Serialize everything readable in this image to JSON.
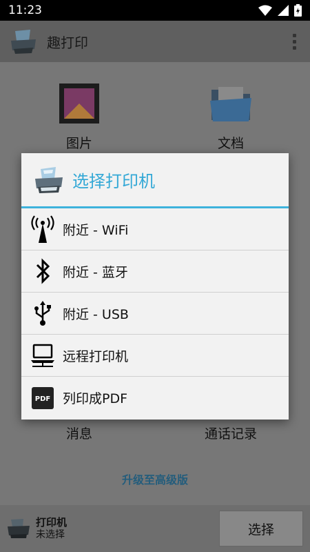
{
  "status_bar": {
    "time": "11:23"
  },
  "app_bar": {
    "title": "趣打印"
  },
  "tiles": {
    "photos": "图片",
    "documents": "文档",
    "messages": "消息",
    "call_log": "通话记录"
  },
  "upgrade": "升级至高级版",
  "bottom_bar": {
    "printer_label": "打印机",
    "printer_status": "未选择",
    "select_label": "选择"
  },
  "dialog": {
    "title": "选择打印机",
    "items": [
      {
        "label": "附近 - WiFi",
        "icon": "wifi-antenna-icon"
      },
      {
        "label": "附近 - 蓝牙",
        "icon": "bluetooth-icon"
      },
      {
        "label": "附近 - USB",
        "icon": "usb-icon"
      },
      {
        "label": "远程打印机",
        "icon": "remote-computer-icon"
      },
      {
        "label": "列印成PDF",
        "icon": "pdf-icon"
      }
    ]
  },
  "colors": {
    "accent": "#3eb3dc",
    "title_blue": "#33a8d6",
    "upgrade_blue": "#245d7c"
  }
}
